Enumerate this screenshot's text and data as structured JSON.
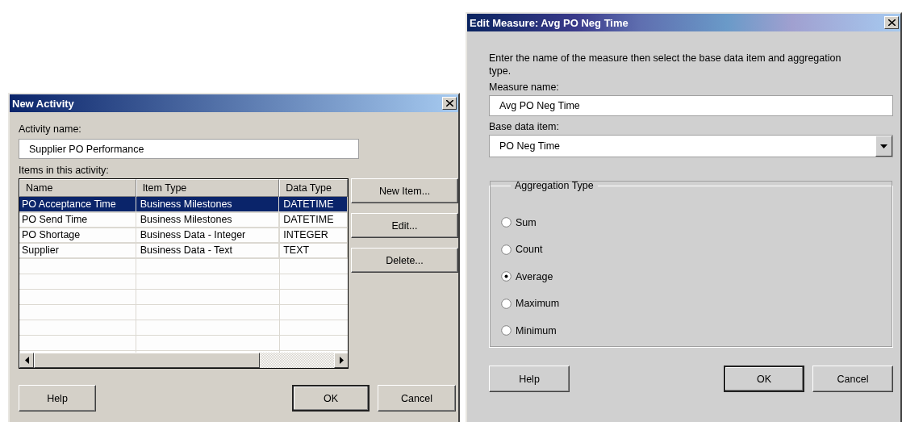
{
  "new_activity": {
    "title": "New Activity",
    "activity_name_label": "Activity name:",
    "activity_name": "Supplier PO Performance",
    "items_label": "Items in this activity:",
    "table": {
      "columns": [
        "Name",
        "Item Type",
        "Data Type"
      ],
      "rows": [
        {
          "cells": [
            "PO Acceptance Time",
            "Business Milestones",
            "DATETIME"
          ],
          "selected": true
        },
        {
          "cells": [
            "PO Send Time",
            "Business Milestones",
            "DATETIME"
          ],
          "selected": false
        },
        {
          "cells": [
            "PO Shortage",
            "Business Data - Integer",
            "INTEGER"
          ],
          "selected": false
        },
        {
          "cells": [
            "Supplier",
            "Business Data - Text",
            "TEXT"
          ],
          "selected": false
        }
      ]
    },
    "side_buttons": [
      "New Item...",
      "Edit...",
      "Delete..."
    ],
    "buttons": [
      {
        "label": "Help",
        "default": false
      },
      {
        "label": "OK",
        "default": true
      },
      {
        "label": "Cancel",
        "default": false
      }
    ]
  },
  "edit_measure": {
    "title": "Edit Measure: Avg PO Neg Time",
    "instructions": "Enter the name of the measure then select the base data item and aggregation type.",
    "measure_name_label": "Measure name:",
    "measure_name": "Avg PO Neg Time",
    "base_item_label": "Base data item:",
    "base_item": "PO Neg Time",
    "aggregation": {
      "title": "Aggregation Type",
      "options": [
        {
          "label": "Sum",
          "selected": false
        },
        {
          "label": "Count",
          "selected": false
        },
        {
          "label": "Average",
          "selected": true
        },
        {
          "label": "Maximum",
          "selected": false
        },
        {
          "label": "Minimum",
          "selected": false
        }
      ]
    },
    "buttons": [
      {
        "label": "Help",
        "default": false
      },
      {
        "label": "OK",
        "default": true
      },
      {
        "label": "Cancel",
        "default": false
      }
    ]
  }
}
